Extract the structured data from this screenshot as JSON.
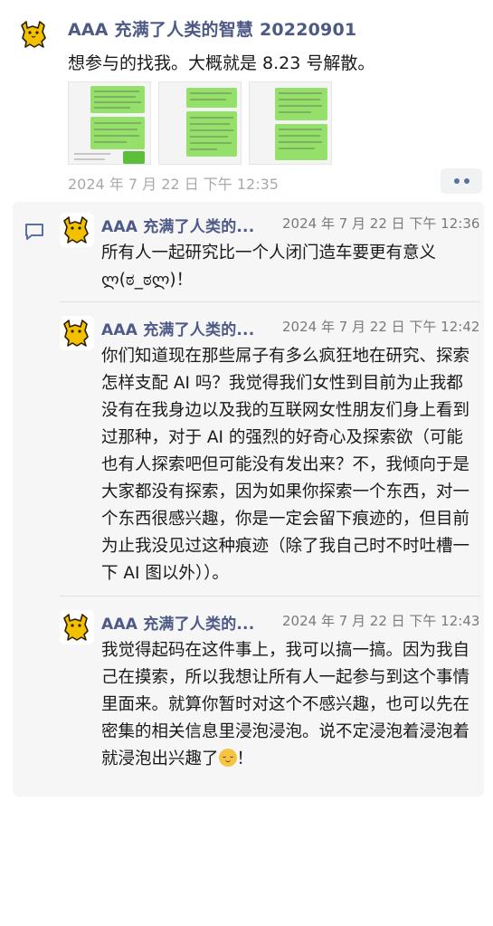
{
  "post": {
    "author": "AAA 充满了人类的智慧 20220901",
    "text": "想参与的找我。大概就是 8.23 号解散。",
    "image_count": 3,
    "timestamp": "2024 年 7 月 22 日 下午 12:35",
    "more_icon": "more-dots-icon"
  },
  "comments": [
    {
      "author": "AAA 充满了人类的...",
      "time": "2024 年 7 月 22 日 下午 12:36",
      "text": "所有人一起研究比一个人闭门造车要更有意义ლ(ಠ_ಠლ)！"
    },
    {
      "author": "AAA 充满了人类的...",
      "time": "2024 年 7 月 22 日 下午 12:42",
      "text": "你们知道现在那些屌子有多么疯狂地在研究、探索怎样支配 AI 吗？我觉得我们女性到目前为止我都没有在我身边以及我的互联网女性朋友们身上看到过那种，对于 AI 的强烈的好奇心及探索欲（可能也有人探索吧但可能没有发出来？不，我倾向于是大家都没有探索，因为如果你探索一个东西，对一个东西很感兴趣，你是一定会留下痕迹的，但目前为止我没见过这种痕迹（除了我自己时不时吐槽一下 AI 图以外））。"
    },
    {
      "author": "AAA 充满了人类的...",
      "time": "2024 年 7 月 22 日 下午 12:43",
      "text": "我觉得起码在这件事上，我可以搞一搞。因为我自己在摸索，所以我想让所有人一起参与到这个事情里面来。就算你暂时对这个不感兴趣，也可以先在密集的相关信息里浸泡浸泡。说不定浸泡着浸泡着就浸泡出兴趣了",
      "text_end": "！"
    }
  ],
  "colors": {
    "author": "#4e5a86",
    "timestamp": "#a9a9a9",
    "comment_bg": "#f6f6f6",
    "bubble_green": "#95e06a"
  }
}
